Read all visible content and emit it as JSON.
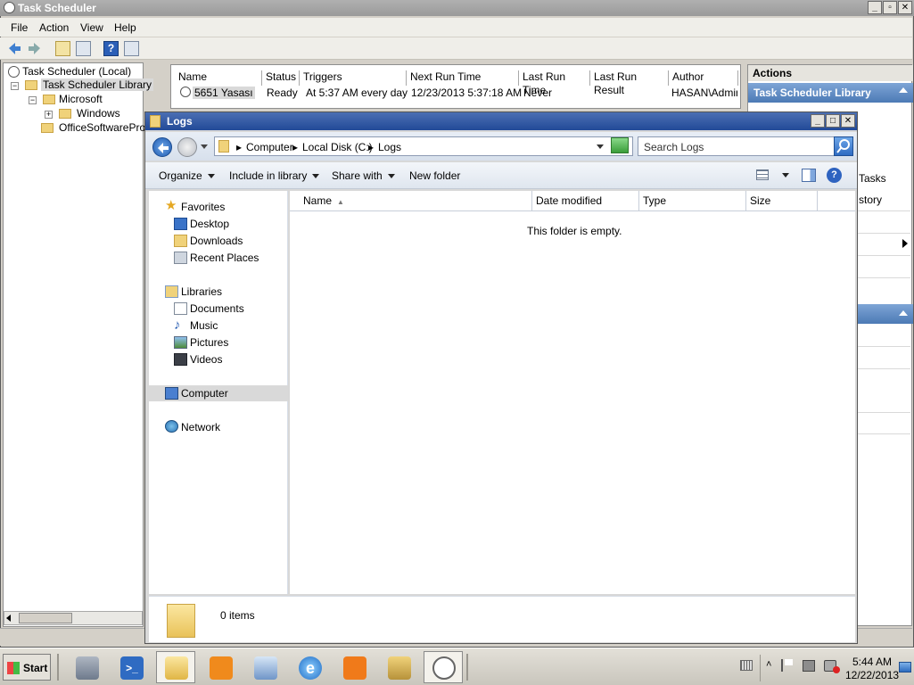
{
  "ts": {
    "title": "Task Scheduler",
    "menu": [
      "File",
      "Action",
      "View",
      "Help"
    ],
    "tree": {
      "root": "Task Scheduler (Local)",
      "library": "Task Scheduler Library",
      "microsoft": "Microsoft",
      "windows": "Windows",
      "office": "OfficeSoftwareProte"
    },
    "columns": [
      "Name",
      "Status",
      "Triggers",
      "Next Run Time",
      "Last Run Time",
      "Last Run Result",
      "Author"
    ],
    "task": {
      "name": "5651 Yasası",
      "status": "Ready",
      "triggers": "At 5:37 AM every day",
      "next_run": "12/23/2013 5:37:18 AM",
      "last_run": "Never",
      "last_result": "",
      "author": "HASAN\\Adminis"
    },
    "actions": {
      "header": "Actions",
      "band": "Task Scheduler Library",
      "tasks_fragment": "Tasks",
      "history_fragment": "story"
    }
  },
  "logs": {
    "title": "Logs",
    "breadcrumb": [
      "Computer",
      "Local Disk (C:)",
      "Logs"
    ],
    "search_placeholder": "Search Logs",
    "commands": [
      "Organize",
      "Include in library",
      "Share with",
      "New folder"
    ],
    "nav": {
      "favorites": "Favorites",
      "desktop": "Desktop",
      "downloads": "Downloads",
      "recent": "Recent Places",
      "libraries": "Libraries",
      "documents": "Documents",
      "music": "Music",
      "pictures": "Pictures",
      "videos": "Videos",
      "computer": "Computer",
      "network": "Network"
    },
    "columns": [
      "Name",
      "Date modified",
      "Type",
      "Size"
    ],
    "empty_message": "This folder is empty.",
    "item_count": "0 items"
  },
  "taskbar": {
    "start": "Start",
    "clock_time": "5:44 AM",
    "clock_date": "12/22/2013"
  }
}
